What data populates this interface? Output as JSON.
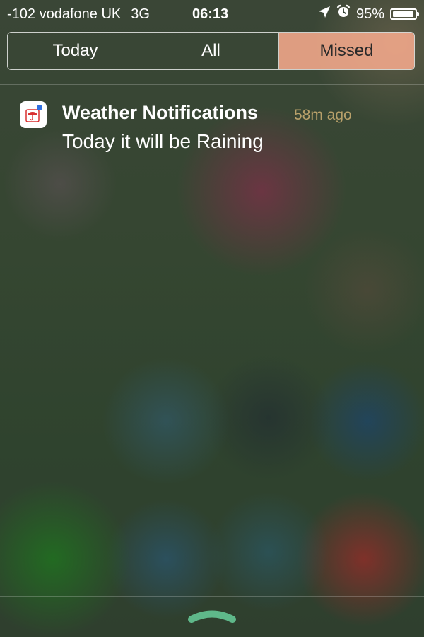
{
  "status_bar": {
    "signal": "-102",
    "carrier": "vodafone UK",
    "network": "3G",
    "time": "06:13",
    "battery_text": "95%",
    "battery_level": 0.95,
    "icons": [
      "location-arrow-icon",
      "alarm-clock-icon",
      "battery-icon"
    ]
  },
  "tabs": [
    {
      "label": "Today",
      "selected": false
    },
    {
      "label": "All",
      "selected": false
    },
    {
      "label": "Missed",
      "selected": true
    }
  ],
  "notifications": [
    {
      "app_icon": "weather-umbrella-app-icon",
      "title": "Weather Notifications",
      "time": "58m ago",
      "message": "Today it will be Raining"
    }
  ],
  "colors": {
    "selected_tab_bg": "#f5aa8c",
    "timestamp": "#b8a06a",
    "grabber": "#5fb88a",
    "umbrella": "#d93030",
    "badge_dot": "#2f6fe0"
  },
  "bottom_handle": {
    "icon": "chevron-up-grabber-icon"
  }
}
